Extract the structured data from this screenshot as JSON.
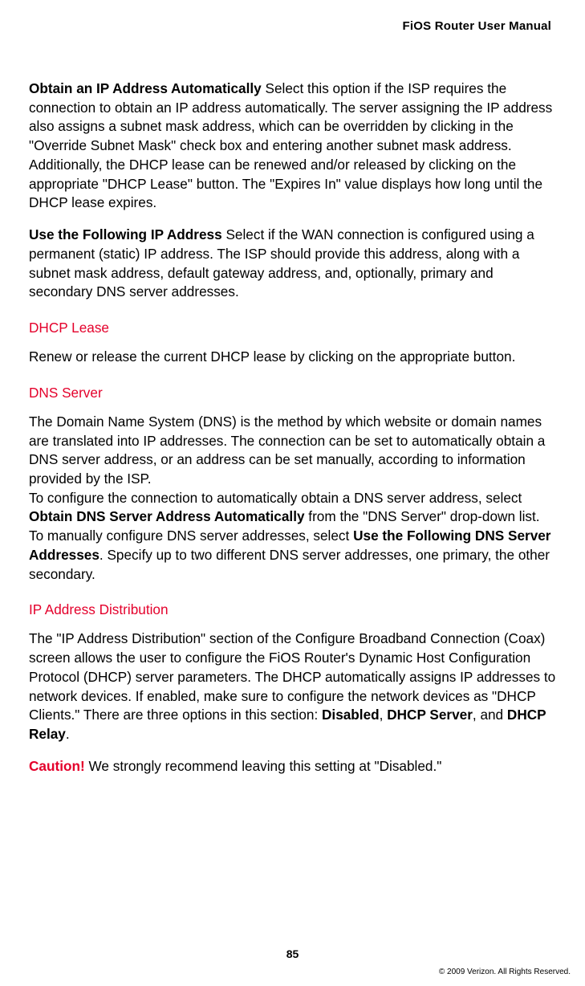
{
  "header": {
    "title": "FiOS Router User Manual"
  },
  "sections": {
    "obtain_ip": {
      "bold_lead": "Obtain an IP Address Automatically",
      "text": "  Select this option if the ISP requires the connection to obtain an IP address automatically. The server assigning the IP address also assigns a subnet mask address, which can be overridden by clicking in the \"Override Subnet Mask\" check box and entering another subnet mask address. Additionally, the DHCP lease can be renewed and/or released by clicking on the appropriate \"DHCP Lease\" button. The \"Expires In\" value displays how long until the DHCP lease expires."
    },
    "use_following": {
      "bold_lead": "Use the Following IP Address",
      "text": "  Select if the WAN connection is configured using a permanent (static) IP address. The ISP should provide this address, along with a subnet mask address, default gateway address, and, optionally, primary and secondary DNS server addresses."
    },
    "dhcp_lease": {
      "heading": "DHCP Lease",
      "text": "Renew or release the current DHCP lease by clicking on the appropriate button."
    },
    "dns_server": {
      "heading": "DNS Server",
      "p1": "The Domain Name System (DNS) is the method by which website or domain names are translated into IP addresses. The connection can be set to automatically obtain a DNS server address, or an address can be set manually, according to information provided by the ISP.",
      "p2_pre": "To configure the connection to automatically obtain a DNS server address, select ",
      "p2_bold1": "Obtain DNS Server Address Automatically",
      "p2_mid": " from the \"DNS Server\" drop-down list.  To manually configure DNS server addresses, select ",
      "p2_bold2": "Use the Following DNS Server Addresses",
      "p2_end": ". Specify up to two different DNS server addresses, one primary, the other secondary."
    },
    "ip_dist": {
      "heading": "IP Address Distribution",
      "p1_pre": "The \"IP Address Distribution\" section of the Configure Broadband Connection (Coax) screen allows the user to configure the FiOS Router's Dynamic Host Configuration Protocol (DHCP) server parameters. The DHCP automatically assigns IP addresses to network devices. If enabled, make sure to configure the network devices as \"DHCP Clients.\" There are three options in this section: ",
      "p1_bold1": "Disabled",
      "p1_sep1": ", ",
      "p1_bold2": "DHCP Server",
      "p1_sep2": ", and ",
      "p1_bold3": "DHCP Relay",
      "p1_end": ".",
      "caution_label": "Caution!",
      "caution_text": " We strongly recommend leaving this setting at \"Disabled.\""
    }
  },
  "footer": {
    "page_number": "85",
    "copyright": "© 2009 Verizon. All Rights Reserved."
  }
}
